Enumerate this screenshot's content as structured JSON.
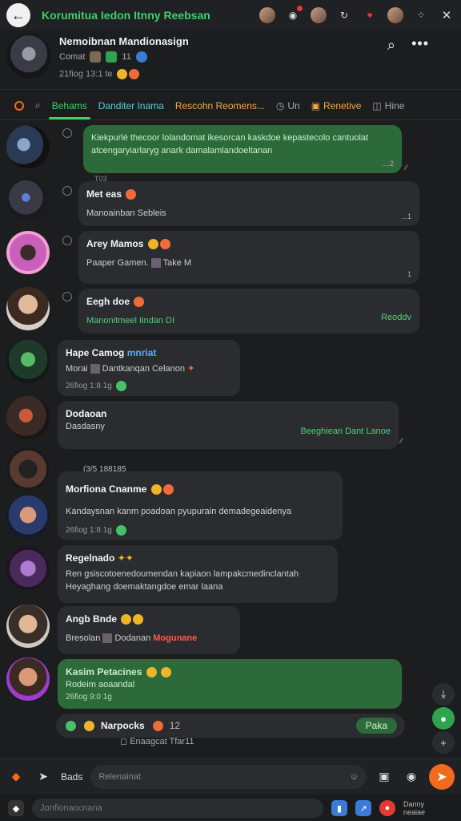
{
  "topbar": {
    "title": "Korumitua Iedon Itnny Reebsan",
    "back_icon": "arrow-left-icon"
  },
  "group": {
    "name": "Nemoibnan Mandionasign",
    "meta": "Comat",
    "meta_extra": "11",
    "date": "21fiog 13:1 te"
  },
  "tabs": [
    {
      "label": "Behams"
    },
    {
      "label": "Danditer Inama"
    },
    {
      "label": "Rescohn Reomens..."
    },
    {
      "label": "Un"
    },
    {
      "label": "Renetive"
    },
    {
      "label": "Hine"
    }
  ],
  "messages": [
    {
      "name": "",
      "text": "Kiekpurlé thecoor lolandomat ikesorcan kaskdoe kepastecolo cantuolat atcengaryiarlaryg anark damalamlandoeltanan",
      "time": "....2",
      "extra": "T03"
    },
    {
      "name": "Met eas",
      "text": "Manoainban Sebleis",
      "time": "...1"
    },
    {
      "name": "Arey Mamos",
      "text": "Paaper Gamen.",
      "text2": "Take M",
      "time": "1"
    },
    {
      "name": "Eegh doe",
      "text": "Manonitmeel Iindan DI",
      "link": "Reoddv",
      "time": ""
    },
    {
      "name": "Hape Camog",
      "name_extra": "mnriat",
      "text": "Morai",
      "text2": "Dantkanqan Celanon",
      "time": "26fiog 1:8 1g"
    },
    {
      "name": "Dodaoan",
      "text": "Dasdasny",
      "link": "Beeghiean Dant Lanoe",
      "time": ""
    },
    {
      "name": "Morfiona Cnanme",
      "text": "Kandaysnan kanm poadoan pyupurain demadegeaidenya",
      "time": "26fiog 1:8 1g",
      "extra": "(3/5 188185"
    },
    {
      "name": "Regelnado",
      "text": "Ren gsiscotoenedoumendan kapiaon lampakcmedinclantah",
      "text2": "Heyaghang doemaktangdoe emar laana",
      "time": ""
    },
    {
      "name": "Angb Bnde",
      "text": "Bresolan",
      "text2": "Dodanan",
      "link": "Mogunane",
      "time": ""
    },
    {
      "name": "Kasim Petacines",
      "text": "Rodeim aoaandal",
      "time": "26fiog 9:0 1g"
    }
  ],
  "reaction": {
    "name": "Narpocks",
    "count": "12",
    "pill": "Paka",
    "reply_prefix": "Enaagcat",
    "reply_suffix": "Tfar11"
  },
  "input": {
    "label": "Bads",
    "placeholder": "Relenainat"
  },
  "bottom": {
    "search": "Jonfionaocnana",
    "badge_text": "Danny neaiae"
  }
}
